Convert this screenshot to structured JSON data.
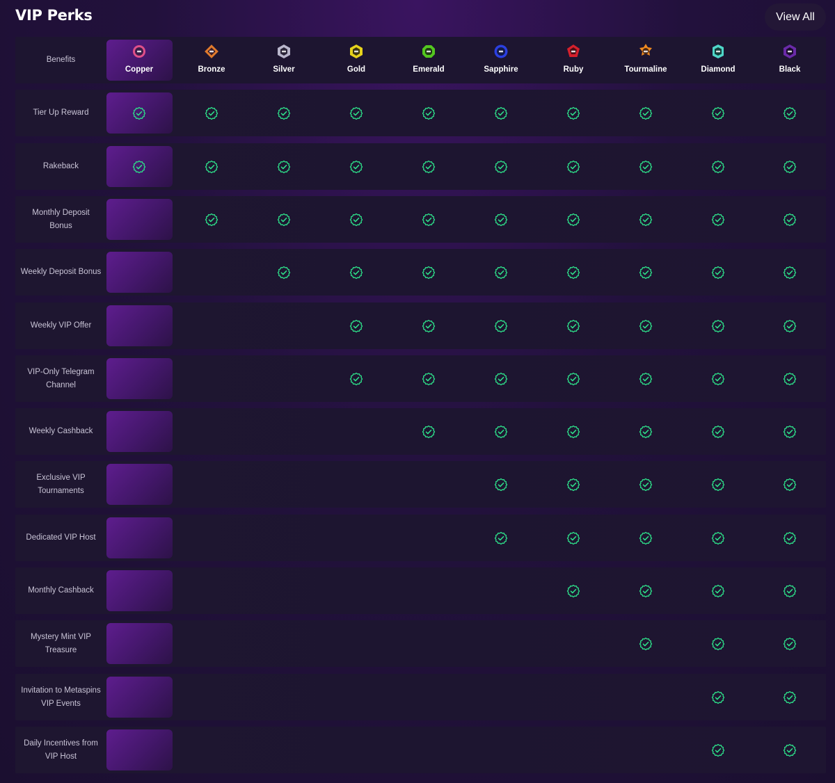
{
  "page": {
    "title": "VIP Perks",
    "view_all_label": "View All"
  },
  "table": {
    "header_label": "Benefits",
    "tiers": [
      {
        "name": "Copper",
        "icon": "copper-badge-icon",
        "color": "#e0508a"
      },
      {
        "name": "Bronze",
        "icon": "bronze-badge-icon",
        "color": "#e07a2c"
      },
      {
        "name": "Silver",
        "icon": "silver-badge-icon",
        "color": "#b9b6cc"
      },
      {
        "name": "Gold",
        "icon": "gold-badge-icon",
        "color": "#e6d21c"
      },
      {
        "name": "Emerald",
        "icon": "emerald-badge-icon",
        "color": "#53c61f"
      },
      {
        "name": "Sapphire",
        "icon": "sapphire-badge-icon",
        "color": "#2b3fe0"
      },
      {
        "name": "Ruby",
        "icon": "ruby-badge-icon",
        "color": "#d4202c"
      },
      {
        "name": "Tourmaline",
        "icon": "tourmaline-badge-icon",
        "color": "#f08a20"
      },
      {
        "name": "Diamond",
        "icon": "diamond-badge-icon",
        "color": "#4fd6c8"
      },
      {
        "name": "Black",
        "icon": "black-badge-icon",
        "color": "#6a2aa8"
      }
    ],
    "benefits": [
      {
        "label": "Tier Up Reward",
        "from_tier": 0
      },
      {
        "label": "Rakeback",
        "from_tier": 0
      },
      {
        "label": "Monthly Deposit Bonus",
        "from_tier": 1
      },
      {
        "label": "Weekly Deposit Bonus",
        "from_tier": 2
      },
      {
        "label": "Weekly VIP Offer",
        "from_tier": 3
      },
      {
        "label": "VIP-Only Telegram Channel",
        "from_tier": 3
      },
      {
        "label": "Weekly Cashback",
        "from_tier": 4
      },
      {
        "label": "Exclusive VIP Tournaments",
        "from_tier": 5
      },
      {
        "label": "Dedicated VIP Host",
        "from_tier": 5
      },
      {
        "label": "Monthly Cashback",
        "from_tier": 6
      },
      {
        "label": "Mystery Mint VIP Treasure",
        "from_tier": 7
      },
      {
        "label": "Invitation to Metaspins VIP Events",
        "from_tier": 8
      },
      {
        "label": "Daily Incentives from VIP Host",
        "from_tier": 8
      }
    ],
    "check_icon": "check-badge-icon",
    "colors": {
      "check": "#2ee08a",
      "highlight": "#5e1d8e"
    }
  }
}
